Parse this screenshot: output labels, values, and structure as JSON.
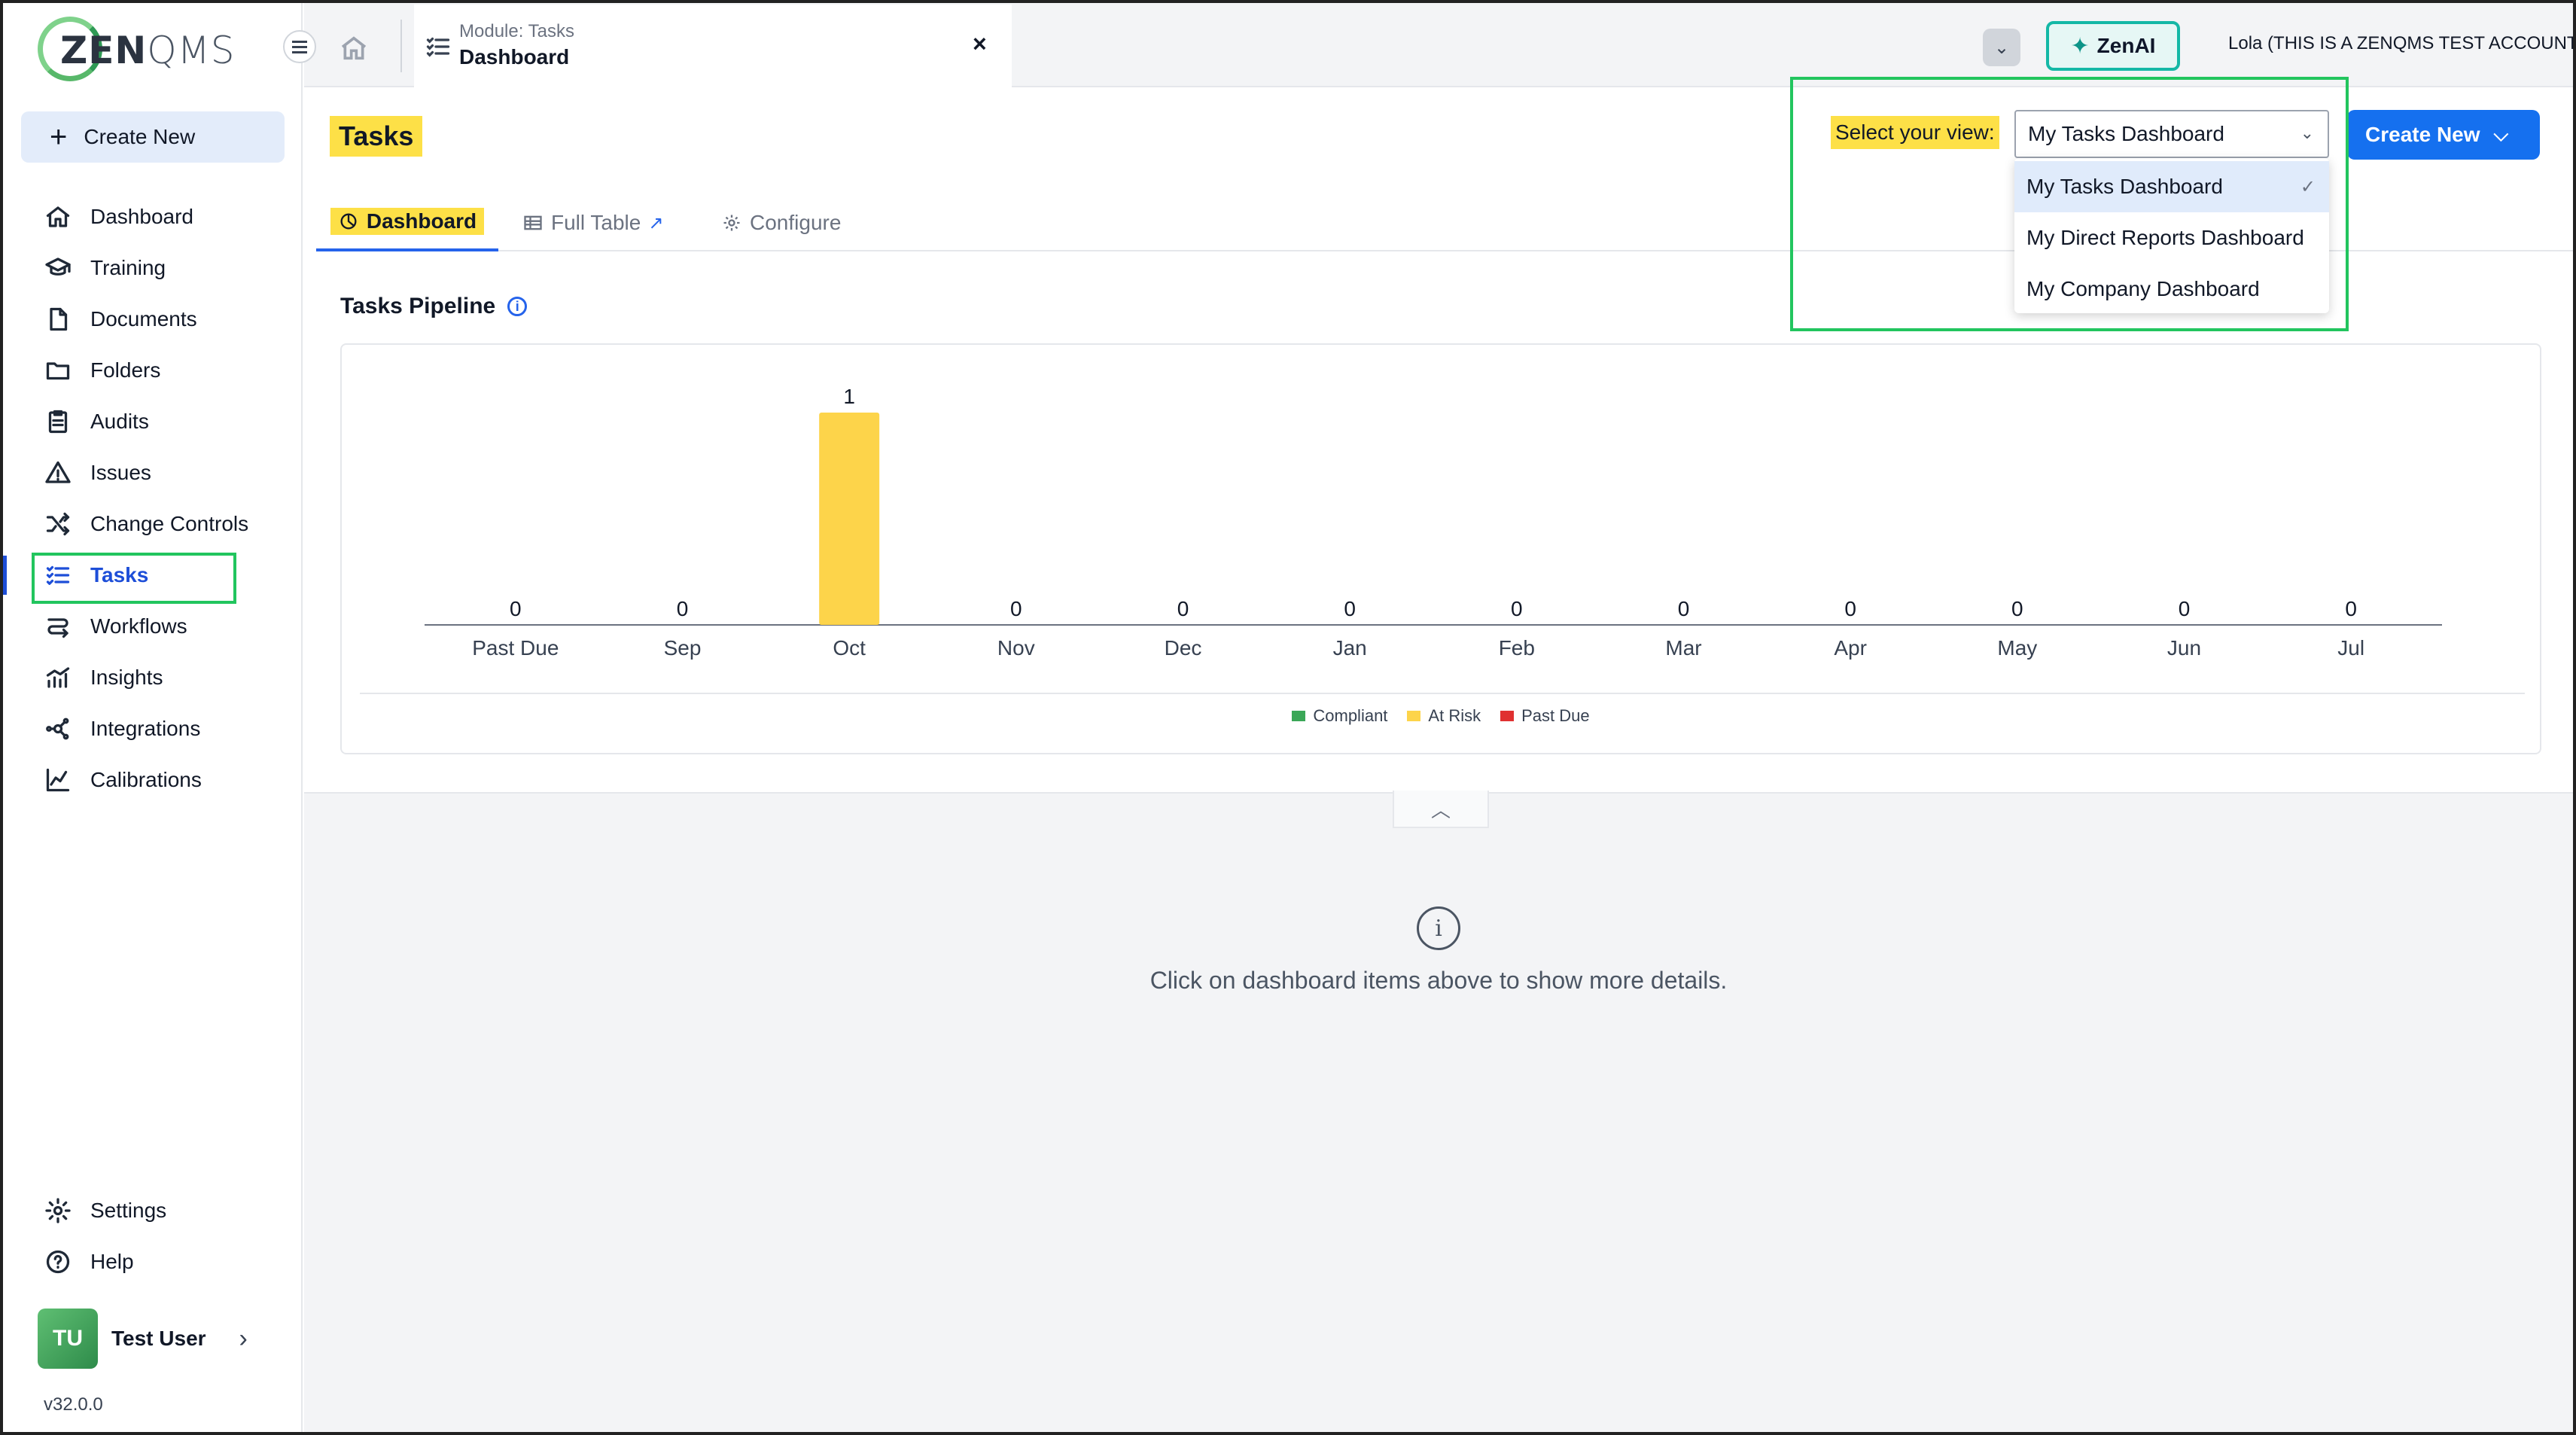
{
  "app": {
    "logo_text_bold": "ZEN",
    "logo_text_light": "QMS",
    "version": "v32.0.0",
    "account": "Lola (THIS IS A ZENQMS TEST ACCOUNT)"
  },
  "sidebar": {
    "create_new": "Create New",
    "items": [
      {
        "label": "Dashboard",
        "icon": "home-icon"
      },
      {
        "label": "Training",
        "icon": "graduation-cap-icon"
      },
      {
        "label": "Documents",
        "icon": "document-icon"
      },
      {
        "label": "Folders",
        "icon": "folder-icon"
      },
      {
        "label": "Audits",
        "icon": "clipboard-icon"
      },
      {
        "label": "Issues",
        "icon": "warning-icon"
      },
      {
        "label": "Change Controls",
        "icon": "shuffle-icon"
      },
      {
        "label": "Tasks",
        "icon": "task-list-icon",
        "active": true
      },
      {
        "label": "Workflows",
        "icon": "workflow-icon"
      },
      {
        "label": "Insights",
        "icon": "insights-icon"
      },
      {
        "label": "Integrations",
        "icon": "integrations-icon"
      },
      {
        "label": "Calibrations",
        "icon": "calibration-chart-icon"
      }
    ],
    "settings": "Settings",
    "help": "Help",
    "user": {
      "initials": "TU",
      "name": "Test User"
    }
  },
  "topbar": {
    "module_tab": {
      "line1": "Module: Tasks",
      "line2": "Dashboard",
      "close": "×"
    },
    "zenai_label": "ZenAI"
  },
  "page": {
    "title": "Tasks",
    "tabs": {
      "dashboard": "Dashboard",
      "full_table": "Full Table",
      "configure": "Configure"
    },
    "view_label": "Select your view:",
    "view_selected": "My Tasks Dashboard",
    "view_options": [
      "My Tasks Dashboard",
      "My Direct Reports Dashboard",
      "My Company Dashboard"
    ],
    "create_new": "Create New",
    "pipeline_title": "Tasks Pipeline",
    "empty_message": "Click on dashboard items above to show more details."
  },
  "chart_data": {
    "type": "bar",
    "categories": [
      "Past Due",
      "Sep",
      "Oct",
      "Nov",
      "Dec",
      "Jan",
      "Feb",
      "Mar",
      "Apr",
      "May",
      "Jun",
      "Jul"
    ],
    "series": [
      {
        "name": "Compliant",
        "color": "#3aa757",
        "values": [
          0,
          0,
          0,
          0,
          0,
          0,
          0,
          0,
          0,
          0,
          0,
          0
        ]
      },
      {
        "name": "At Risk",
        "color": "#fdd44a",
        "values": [
          0,
          0,
          1,
          0,
          0,
          0,
          0,
          0,
          0,
          0,
          0,
          0
        ]
      },
      {
        "name": "Past Due",
        "color": "#e03131",
        "values": [
          0,
          0,
          0,
          0,
          0,
          0,
          0,
          0,
          0,
          0,
          0,
          0
        ]
      }
    ],
    "totals": [
      0,
      0,
      1,
      0,
      0,
      0,
      0,
      0,
      0,
      0,
      0,
      0
    ],
    "ylim": [
      0,
      1
    ],
    "legend_position": "bottom"
  }
}
